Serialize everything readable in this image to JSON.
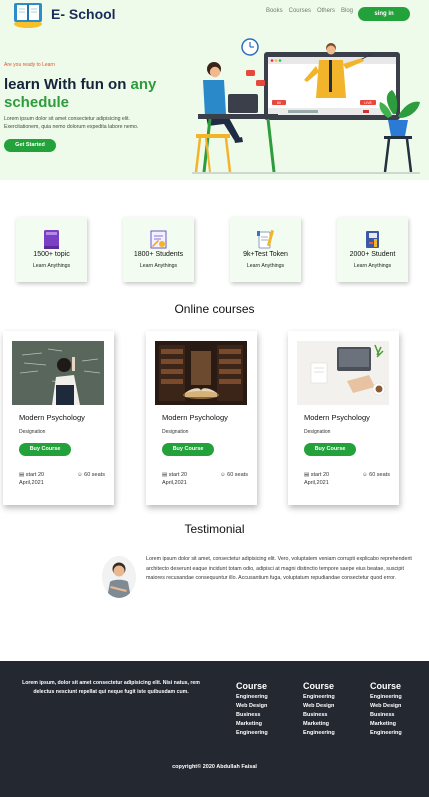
{
  "header": {
    "brand": "E- School",
    "nav": [
      "Books",
      "Courses",
      "Others",
      "Blog"
    ],
    "signin_label": "sing in"
  },
  "hero": {
    "eyebrow": "Are you ready to Learn",
    "headline_part1": "learn With fun on ",
    "headline_accent": "any schedule",
    "text": "Lorem ipsum dolor sit amet consectetur adipisicing elit. Exercitationem, quia nemo dolorum expedita labore nemo.",
    "cta": "Get Started",
    "screen_badge_left": "80",
    "screen_badge_right": "LIVE"
  },
  "stats": [
    {
      "icon": "book-icon",
      "value": "1500+ topic",
      "label": "Learn Anythings"
    },
    {
      "icon": "certificate-icon",
      "value": "1800+ Students",
      "label": "Learn Anythings"
    },
    {
      "icon": "token-icon",
      "value": "9k+Test Token",
      "label": "Learn Anythings"
    },
    {
      "icon": "notebook-icon",
      "value": "2000+ Student",
      "label": "Learn Anythings"
    }
  ],
  "courses_title": "Online courses",
  "courses": [
    {
      "title": "Modern Psychology",
      "designation": "Designation",
      "buy": "Buy Course",
      "start": "start 20 April,2021",
      "seats": "60 seats"
    },
    {
      "title": "Modern Psychology",
      "designation": "Designation",
      "buy": "Buy Course",
      "start": "start 20 April,2021",
      "seats": "60 seats"
    },
    {
      "title": "Modern Psychology",
      "designation": "Designation",
      "buy": "Buy Course",
      "start": "start 20 April,2021",
      "seats": "60 seats"
    }
  ],
  "testimonial": {
    "title": "Testimonial",
    "text": "Lorem ipsum dolor sit amet, consectetur adipisicing elit. Vero, voluptatem veniam corrupti explicabo reprehenderit architecto deserunt eaque incidunt totam odio, adipisci at magni distinctio tempore saepe eius beatae, suscipit maiores recusandae consequuntur illo. Accusantium fuga, voluptatum repudiandae consectetur quod error."
  },
  "footer": {
    "about": "Lorem ipsum, dolor sit amet consectetur adipisicing elit. Nisi natus, rem delectus nesciunt repellat qui neque fugit iste quibusdam cum.",
    "columns": [
      {
        "heading": "Course",
        "items": [
          "Engineering",
          "Web Design",
          "Business",
          "Marketing",
          "Engineering"
        ]
      },
      {
        "heading": "Course",
        "items": [
          "Engineering",
          "Web Design",
          "Business",
          "Marketing",
          "Engineering"
        ]
      },
      {
        "heading": "Course",
        "items": [
          "Engineering",
          "Web Design",
          "Business",
          "Marketing",
          "Engineering"
        ]
      }
    ],
    "copyright": "copyright© 2020 Abdullah Faisal"
  },
  "colors": {
    "accent": "#23a23c",
    "hero_bg": "#eefbea",
    "footer_bg": "#242830",
    "eyebrow": "#e0542c"
  }
}
